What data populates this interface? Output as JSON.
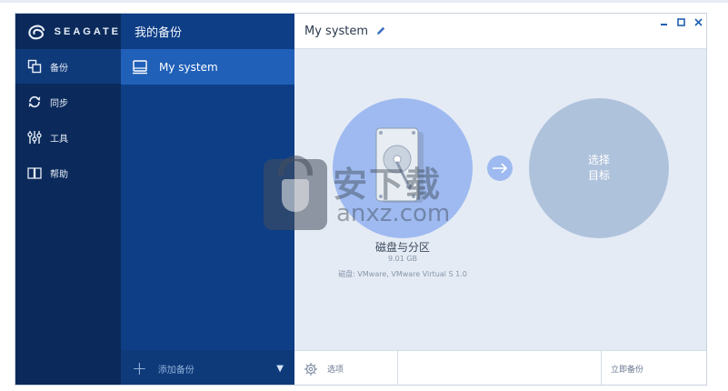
{
  "app": {
    "brand": "SEAGATE"
  },
  "nav": {
    "items": [
      {
        "label": "备份",
        "icon": "copy-icon",
        "active": true
      },
      {
        "label": "同步",
        "icon": "sync-icon",
        "active": false
      },
      {
        "label": "工具",
        "icon": "tools-sliders-icon",
        "active": false
      },
      {
        "label": "帮助",
        "icon": "book-icon",
        "active": false
      }
    ]
  },
  "backups": {
    "header": "我的备份",
    "items": [
      {
        "label": "My system",
        "icon": "computer-icon"
      }
    ],
    "add_label": "添加备份"
  },
  "main": {
    "title": "My system",
    "source": {
      "title": "磁盘与分区",
      "size": "9.01 GB",
      "disk": "磁盘: VMware, VMware Virtual S 1.0"
    },
    "destination": {
      "line1": "选择",
      "line2": "目标"
    },
    "footer": {
      "options_label": "选项",
      "backup_now_label": "立即备份"
    }
  },
  "watermark": {
    "cn": "安下载",
    "en": "anxz.com"
  },
  "colors": {
    "nav_bg": "#0b2a5b",
    "backups_bg": "#0e3e86",
    "selected_item": "#2060b8",
    "main_bg": "#e4ebf5",
    "source_circle": "#9ebaf0",
    "destination_circle": "#afc2dc"
  }
}
